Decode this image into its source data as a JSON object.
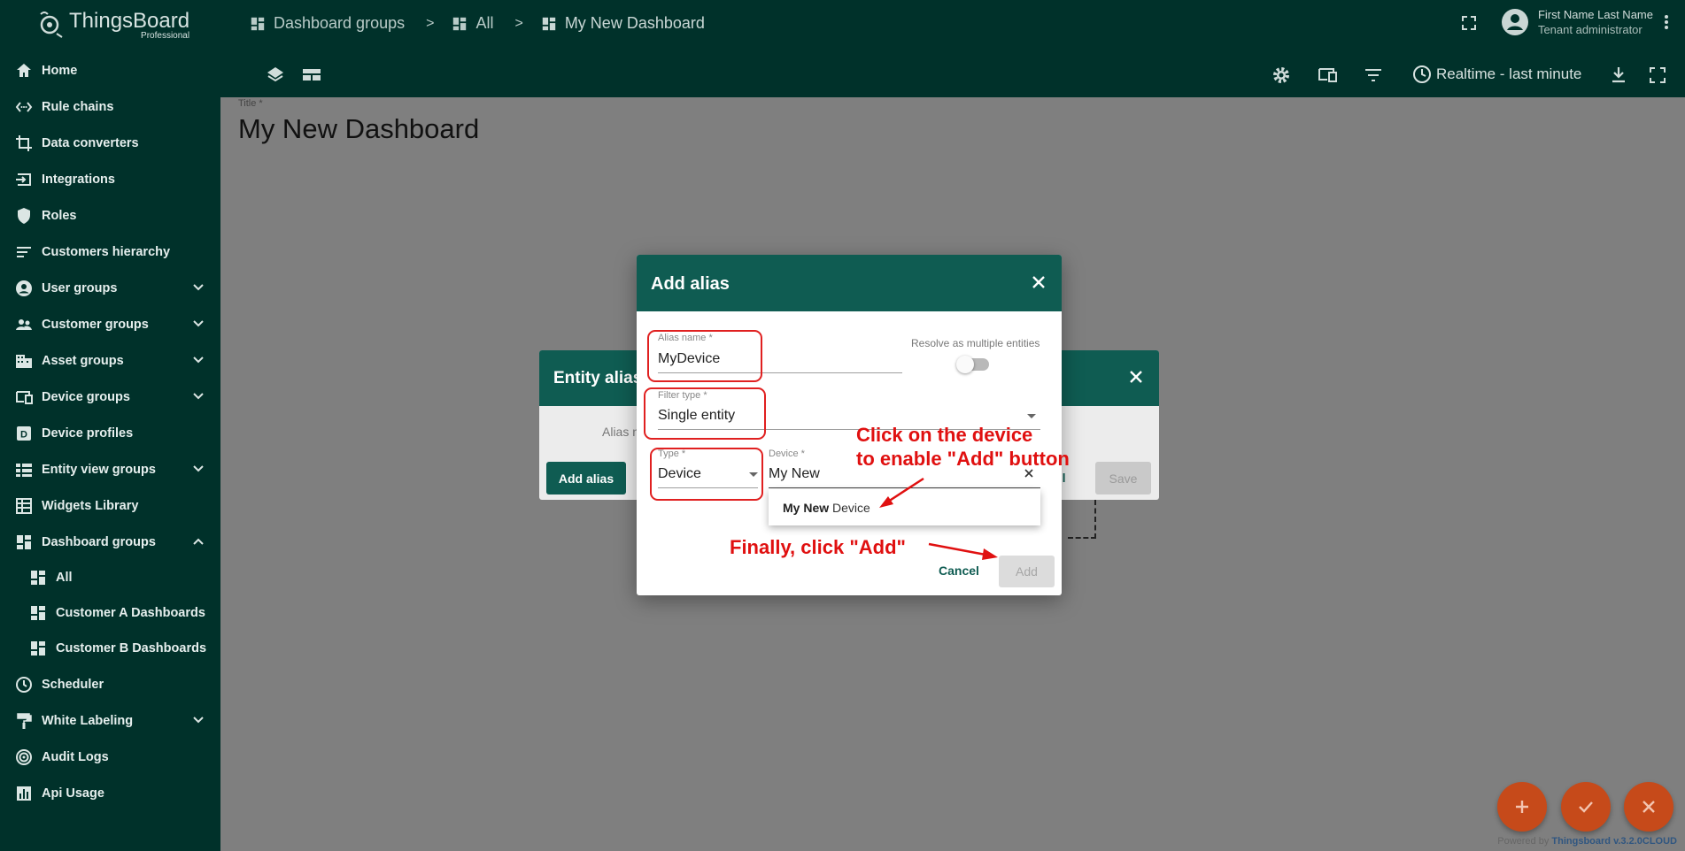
{
  "app": {
    "name": "ThingsBoard",
    "edition": "Professional"
  },
  "sidebar": {
    "items": [
      {
        "label": "Home",
        "icon": "home-icon"
      },
      {
        "label": "Rule chains",
        "icon": "rule-chains-icon"
      },
      {
        "label": "Data converters",
        "icon": "data-converters-icon"
      },
      {
        "label": "Integrations",
        "icon": "integrations-icon"
      },
      {
        "label": "Roles",
        "icon": "shield-icon"
      },
      {
        "label": "Customers hierarchy",
        "icon": "hierarchy-icon"
      },
      {
        "label": "User groups",
        "icon": "user-icon"
      },
      {
        "label": "Customer groups",
        "icon": "customers-icon"
      },
      {
        "label": "Asset groups",
        "icon": "asset-icon"
      },
      {
        "label": "Device groups",
        "icon": "device-icon"
      },
      {
        "label": "Device profiles",
        "icon": "device-profile-icon"
      },
      {
        "label": "Entity view groups",
        "icon": "entity-view-icon"
      },
      {
        "label": "Widgets Library",
        "icon": "widgets-icon"
      },
      {
        "label": "Dashboard groups",
        "icon": "dashboard-icon"
      },
      {
        "label": "All",
        "icon": "dashboard-icon"
      },
      {
        "label": "Customer A Dashboards",
        "icon": "dashboard-icon"
      },
      {
        "label": "Customer B Dashboards",
        "icon": "dashboard-icon"
      },
      {
        "label": "Scheduler",
        "icon": "clock-icon"
      },
      {
        "label": "White Labeling",
        "icon": "brush-icon"
      },
      {
        "label": "Audit Logs",
        "icon": "audit-icon"
      },
      {
        "label": "Api Usage",
        "icon": "chart-icon"
      }
    ]
  },
  "header": {
    "breadcrumbs": [
      "Dashboard groups",
      "All",
      "My New Dashboard"
    ],
    "separator": ">",
    "user_name": "First Name Last Name",
    "user_role": "Tenant administrator",
    "timewindow": "Realtime - last minute"
  },
  "dashboard": {
    "title_label": "Title *",
    "title": "My New  Dashboard"
  },
  "entity_aliases_dialog": {
    "title": "Entity alias",
    "subtitle": "Alias n",
    "add_alias": "Add alias",
    "cancel": "cel",
    "save": "Save"
  },
  "add_alias_dialog": {
    "title": "Add alias",
    "alias_name_label": "Alias name *",
    "alias_name": "MyDevice",
    "resolve_multiple_label": "Resolve as multiple entities",
    "filter_type_label": "Filter type *",
    "filter_type": "Single entity",
    "type_label": "Type *",
    "type": "Device",
    "device_label": "Device *",
    "device_query": "My New",
    "option_match": "My New",
    "option_rest": " Device",
    "cancel": "Cancel",
    "add": "Add"
  },
  "annotations": {
    "click_device_line1": "Click on the device",
    "click_device_line2": "to enable \"Add\" button",
    "finally": "Finally, click \"Add\""
  },
  "footer": {
    "powered_by": "Powered by",
    "version": "Thingsboard v.3.2.0CLOUD"
  },
  "colors": {
    "sidebar": "#00312a",
    "primary": "#0f5c52",
    "fab": "#c64a1a",
    "annotation": "#e01010"
  }
}
